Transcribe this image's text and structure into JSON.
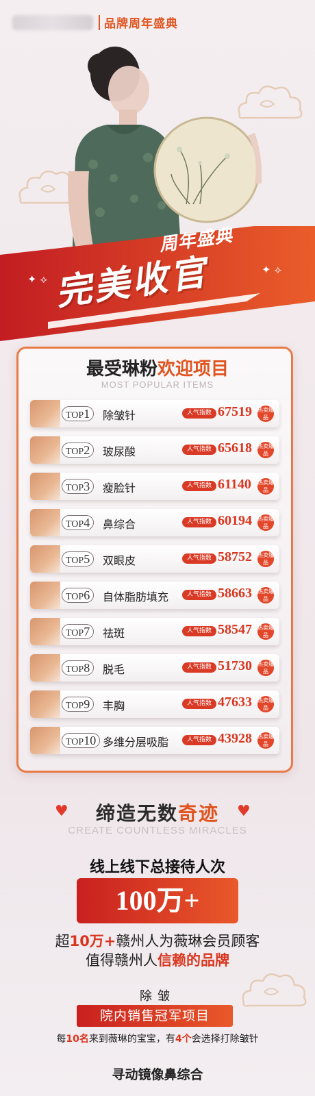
{
  "header": {
    "brand_tag": "品牌周年盛典"
  },
  "banner": {
    "title_small": "周年盛典",
    "title_large": "完美收官"
  },
  "ranking": {
    "title_part1": "最受琳粉",
    "title_part2": "欢迎项目",
    "subtitle": "MOST POPULAR ITEMS",
    "rank_prefix": "TOP",
    "index_label": "人气指数",
    "hot_badge": "热卖爆品",
    "items": [
      {
        "rank": "1",
        "name": "除皱针",
        "score": "67519"
      },
      {
        "rank": "2",
        "name": "玻尿酸",
        "score": "65618"
      },
      {
        "rank": "3",
        "name": "瘦脸针",
        "score": "61140"
      },
      {
        "rank": "4",
        "name": "鼻综合",
        "score": "60194"
      },
      {
        "rank": "5",
        "name": "双眼皮",
        "score": "58752"
      },
      {
        "rank": "6",
        "name": "自体脂肪填充",
        "score": "58663"
      },
      {
        "rank": "7",
        "name": "祛斑",
        "score": "58547"
      },
      {
        "rank": "8",
        "name": "脱毛",
        "score": "51730"
      },
      {
        "rank": "9",
        "name": "丰胸",
        "score": "47633"
      },
      {
        "rank": "10",
        "name": "多维分层吸脂",
        "score": "43928"
      }
    ]
  },
  "miracles": {
    "title_part1": "缔造无数",
    "title_part2": "奇迹",
    "subtitle": "CREATE COUNTLESS MIRACLES",
    "visits_label": "线上线下总接待人次",
    "visits_value": "100万+",
    "line1_a": "超",
    "line1_hl": "10万+",
    "line1_b": "赣州人为薇琳会员顾客",
    "line2_a": "值得赣州人",
    "line2_hl": "信赖的品牌",
    "category1": "除皱",
    "champion_label": "院内销售冠军项目",
    "note_a": "每",
    "note_hl1": "10名",
    "note_b": "来到薇琳的宝宝，有",
    "note_hl2": "4个",
    "note_c": "会选择打除皱针",
    "category2": "寻动镜像鼻综合"
  },
  "colors": {
    "accent": "#e0541f",
    "red": "#d9361f",
    "border": "#e87a45"
  }
}
